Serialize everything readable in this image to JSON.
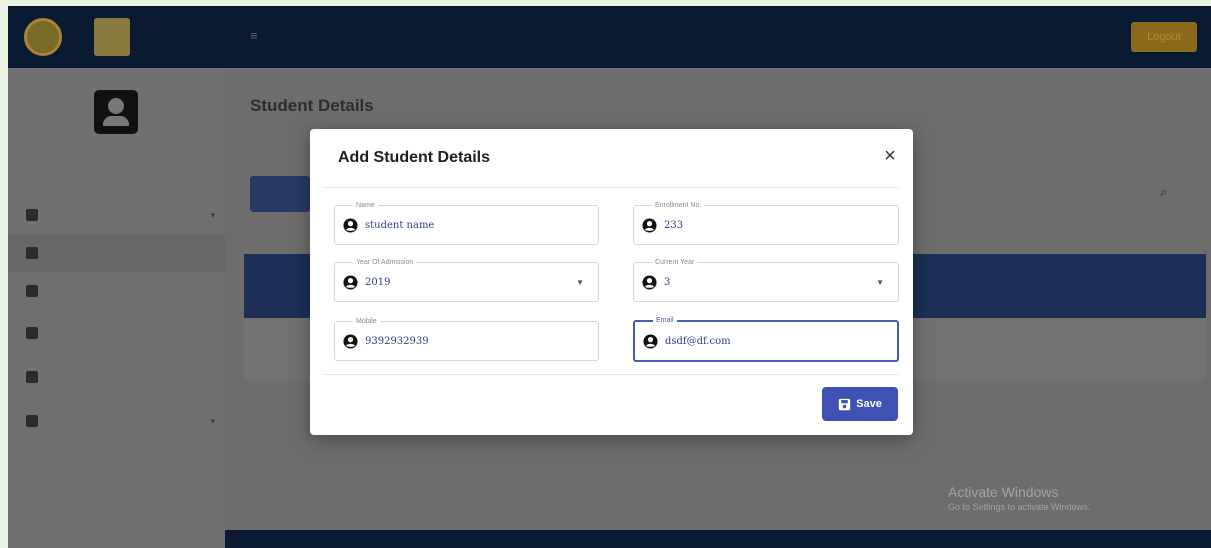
{
  "header": {
    "logout_label": "Logout"
  },
  "page": {
    "title": "Student Details"
  },
  "modal": {
    "title": "Add Student Details",
    "close_glyph": "×",
    "fields": {
      "name": {
        "label": "Name",
        "value": "student name"
      },
      "enrollment": {
        "label": "Enrollment No.",
        "value": "233"
      },
      "year_of_admission": {
        "label": "Year Of Admission",
        "value": "2019"
      },
      "current_year": {
        "label": "Current Year",
        "value": "3"
      },
      "mobile": {
        "label": "Mobile",
        "value": "9392932939"
      },
      "email": {
        "label": "Email",
        "value": "dsdf@df.com"
      }
    },
    "save_label": "Save"
  },
  "overlay": {
    "activate_title": "Activate Windows",
    "activate_sub": "Go to Settings to activate Windows."
  },
  "colors": {
    "primary": "#3f51b5",
    "value_text": "#2c3e8c",
    "topbar": "#0b1a33"
  }
}
